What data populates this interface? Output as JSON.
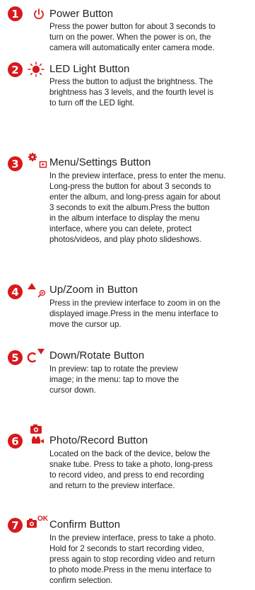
{
  "items": [
    {
      "number": "1",
      "icon": "power-icon",
      "title": "Power Button",
      "lines": [
        "Press the power button for about 3 seconds to",
        "turn on the power. When the power is on, the",
        "camera will automatically enter camera mode."
      ]
    },
    {
      "number": "2",
      "icon": "led-light-icon",
      "title": "LED Light Button",
      "lines": [
        "Press the button to adjust the brightness. The",
        "brightness has 3 levels, and the fourth level is",
        "to turn off the LED light."
      ]
    },
    {
      "number": "3",
      "icon": "gear-menu-icon",
      "title": "Menu/Settings Button",
      "lines": [
        "In the preview interface, press to enter the menu.",
        "Long-press the button for about 3 seconds to",
        "enter the album, and long-press again for about",
        "3 seconds to exit the album.Press the button",
        "in the album interface to display the menu",
        "interface, where you can delete, protect",
        "photos/videos, and play photo slideshows."
      ]
    },
    {
      "number": "4",
      "icon": "up-zoom-icon",
      "title": "Up/Zoom in Button",
      "lines": [
        "Press in the preview interface to zoom in on the",
        "displayed image.Press in the menu interface to",
        "move the cursor up."
      ]
    },
    {
      "number": "5",
      "icon": "down-rotate-icon",
      "title": "Down/Rotate Button",
      "lines": [
        "In preview: tap to rotate the preview",
        "image; in the menu: tap to move the",
        "cursor down."
      ]
    },
    {
      "number": "6",
      "icon": "photo-record-icon",
      "title": "Photo/Record Button",
      "lines": [
        "Located on the back of the device, below the",
        "snake tube. Press to take a photo, long-press",
        "to record video, and press to end recording",
        "and return to the preview interface."
      ]
    },
    {
      "number": "7",
      "icon": "camera-ok-icon",
      "icon_label": "OK",
      "title": "Confirm Button",
      "lines": [
        "In the preview interface, press to take a photo.",
        "Hold for 2 seconds to start recording video,",
        "press again to stop recording video and return",
        "to photo mode.Press in the menu interface to",
        "confirm selection."
      ]
    }
  ],
  "colors": {
    "accent": "#d7191c",
    "text": "#222222"
  }
}
